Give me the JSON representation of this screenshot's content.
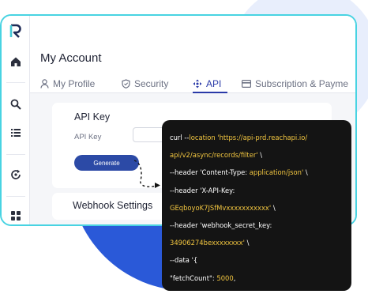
{
  "colors": {
    "accent": "#2a3aa8",
    "window_border": "#48d3e2",
    "generate_button": "#2c4aa6",
    "code_background": "#141414",
    "code_highlight": "#f2c640",
    "background_blob": "#2a59d8"
  },
  "sidebar": {
    "logo": "reachapi-logo",
    "items": [
      {
        "icon": "home-icon"
      },
      {
        "icon": "search-icon"
      },
      {
        "icon": "list-icon"
      },
      {
        "icon": "refresh-icon"
      },
      {
        "icon": "grid-icon"
      }
    ]
  },
  "header": {
    "title": "My Account"
  },
  "tabs": [
    {
      "label": "My Profile",
      "icon": "person-icon"
    },
    {
      "label": "Security",
      "icon": "shield-icon"
    },
    {
      "label": "API",
      "icon": "move-icon",
      "active": true
    },
    {
      "label": "Subscription & Payme",
      "icon": "card-icon"
    }
  ],
  "api_card": {
    "title": "API Key",
    "field_label": "API Key",
    "field_value": "",
    "generate_label": "Generate"
  },
  "webhook_card": {
    "title": "Webhook Settings"
  },
  "code": {
    "lines": [
      {
        "plain": "curl --",
        "hl": "location 'https://api-prd.reachapi.io/"
      },
      {
        "plain": "",
        "hl": "api/v2/async/records/filter'",
        "tail": " \\"
      },
      {
        "plain": "--header 'Content-Type: ",
        "hl": "application/json'",
        "tail": " \\"
      },
      {
        "plain": "--header 'X-API-Key:"
      },
      {
        "plain": "",
        "hl": "GEqboyoK7JSfMvxxxxxxxxxxx'",
        "tail": " \\"
      },
      {
        "plain": "--header 'webhook_secret_key:"
      },
      {
        "plain": "",
        "hl": "34906274bexxxxxxxx'",
        "tail": " \\"
      },
      {
        "plain": "--data '{"
      },
      {
        "plain": "\"fetchCount\": ",
        "hl": "5000",
        "tail": ","
      }
    ]
  }
}
